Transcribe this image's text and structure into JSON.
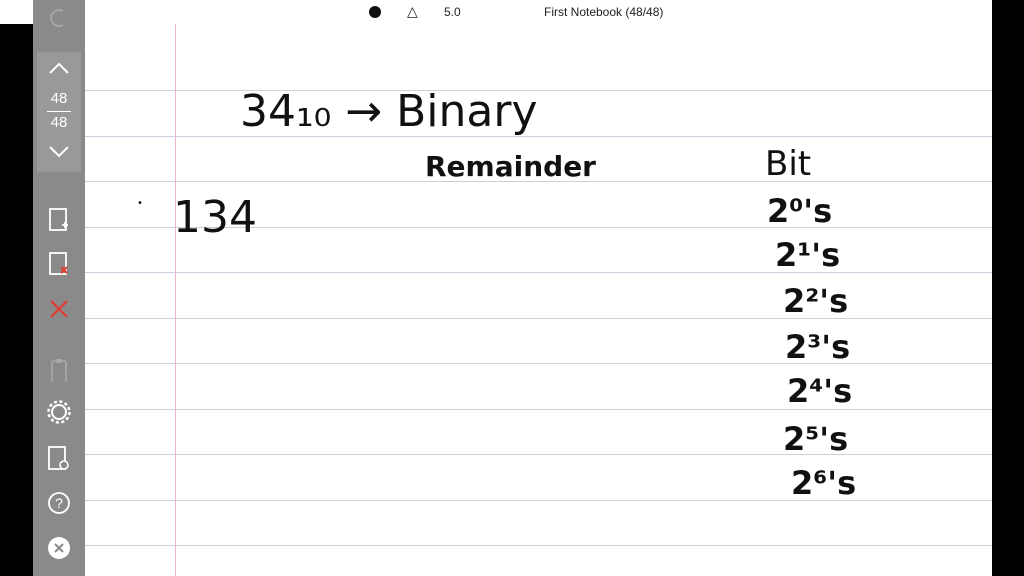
{
  "topbar": {
    "pen_size": "5.0",
    "notebook_title": "First Notebook (48/48)"
  },
  "sidebar": {
    "page_current": "48",
    "page_total": "48",
    "icons": [
      "undo-icon",
      "page-up-icon",
      "page-down-icon",
      "add-page-icon",
      "delete-page-icon",
      "close-red-icon",
      "clip-icon",
      "settings-gear-icon",
      "page-settings-icon",
      "help-icon",
      "exit-icon"
    ]
  },
  "notes": {
    "line1": "34₁₀ → Binary",
    "line2": "Remainder",
    "number": "134",
    "bit_header": "Bit",
    "bits": [
      "2⁰'s",
      "2¹'s",
      "2²'s",
      "2³'s",
      "2⁴'s",
      "2⁵'s",
      "2⁶'s"
    ]
  },
  "colors": {
    "sidebar_bg": "#8a8a8a",
    "rule": "#c9d0de",
    "margin": "#e7b8cf",
    "delete": "#e53935"
  }
}
